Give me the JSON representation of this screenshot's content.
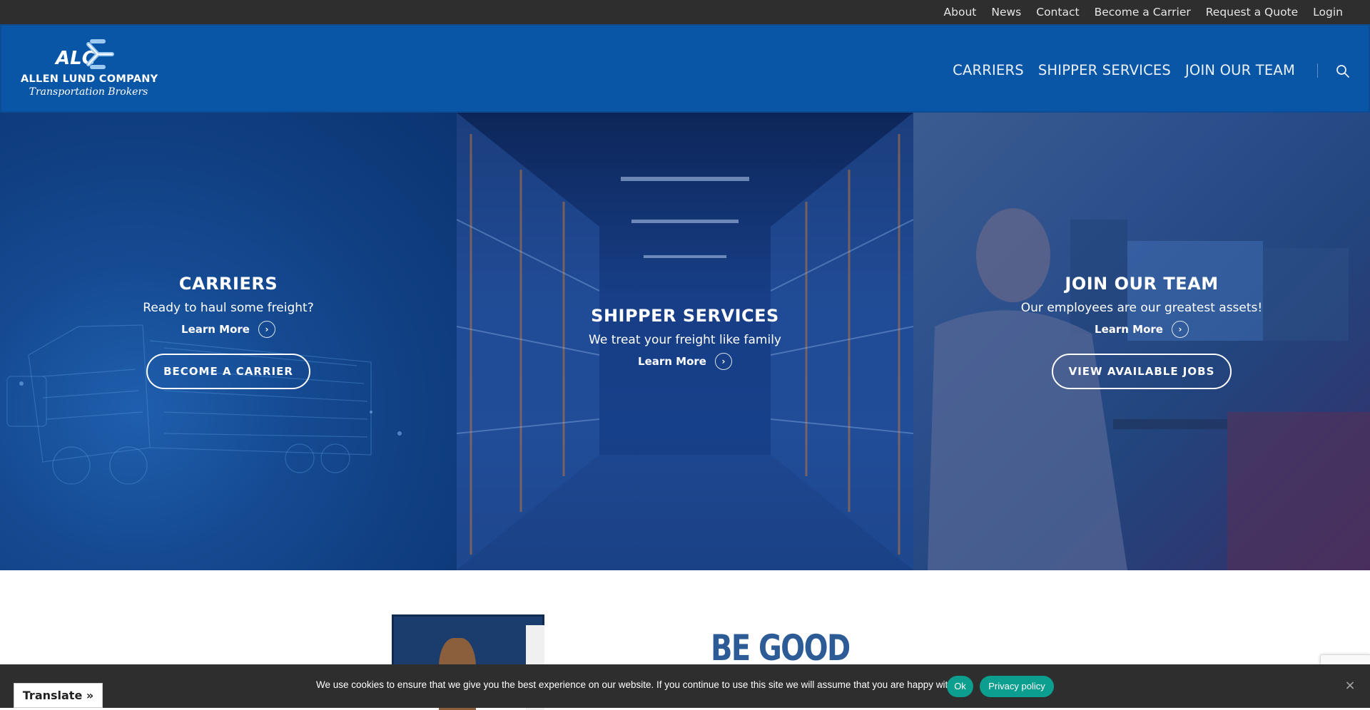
{
  "topbar": {
    "links": [
      "About",
      "News",
      "Contact",
      "Become a Carrier",
      "Request a Quote",
      "Login"
    ]
  },
  "header": {
    "logo_mark": "ALC",
    "logo_name": "ALLEN LUND COMPANY",
    "logo_tagline": "Transportation Brokers",
    "nav": [
      "CARRIERS",
      "SHIPPER SERVICES",
      "JOIN OUR TEAM"
    ],
    "search_icon": "search-icon"
  },
  "hero": {
    "panels": [
      {
        "title": "CARRIERS",
        "subtitle": "Ready to haul some freight?",
        "learn_more": "Learn More",
        "cta": "BECOME A CARRIER"
      },
      {
        "title": "SHIPPER SERVICES",
        "subtitle": "We treat your freight like family",
        "learn_more": "Learn More"
      },
      {
        "title": "JOIN OUR TEAM",
        "subtitle": "Our employees are our greatest assets!",
        "learn_more": "Learn More",
        "cta": "VIEW AVAILABLE JOBS"
      }
    ]
  },
  "section": {
    "heading": "BE GOOD"
  },
  "cookie": {
    "text": "We use cookies to ensure that we give you the best experience on our website. If you continue to use this site we will assume that you are happy with it.",
    "ok": "Ok",
    "privacy": "Privacy policy",
    "close": "×"
  },
  "translate": {
    "label": "Translate »"
  },
  "colors": {
    "topbar": "#2e2e2e",
    "header": "#0a56a6",
    "cookie_button": "#0c9e8f",
    "heading": "#2d5b96"
  }
}
